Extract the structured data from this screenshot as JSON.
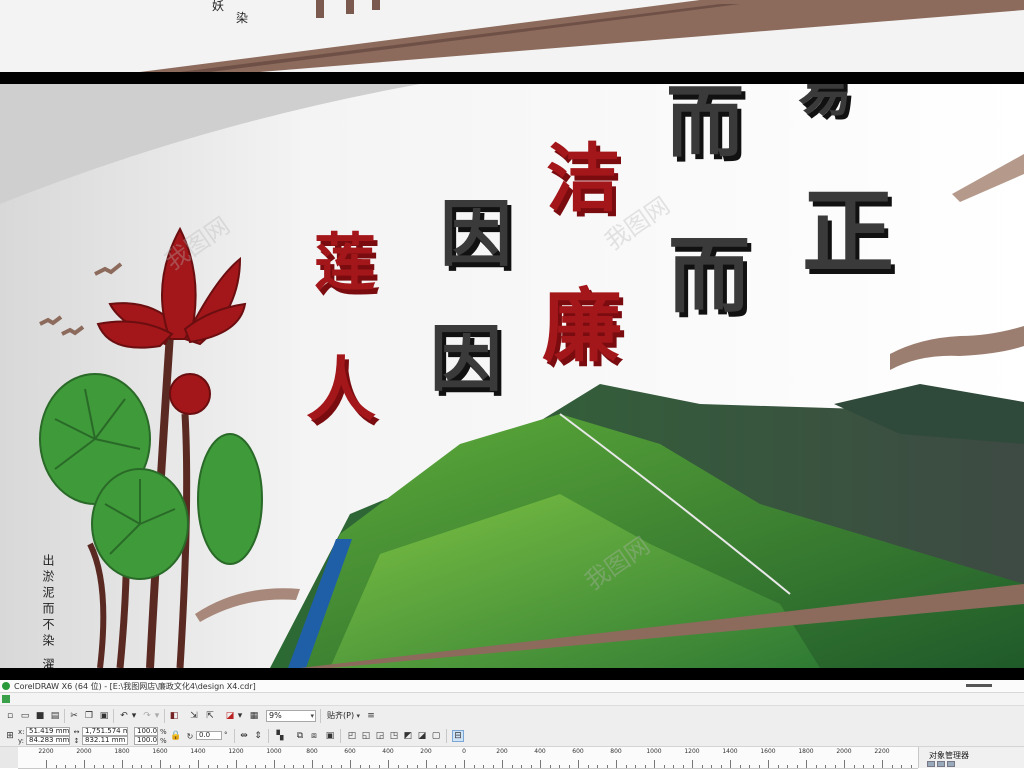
{
  "preview": {
    "top_panel_chars": [
      "妖",
      "染"
    ],
    "main_panel": {
      "red_chars": [
        "莲",
        "人",
        "洁",
        "廉"
      ],
      "dark_chars": [
        "因",
        "因",
        "而",
        "而",
        "正",
        "易"
      ],
      "side_text": "出淤泥而不染 濯清涟而不妖"
    },
    "watermark": "我图网"
  },
  "app": {
    "title": "CorelDRAW X6 (64 位) - [E:\\我图网店\\廉政文化4\\design X4.cdr]"
  },
  "toolbar": {
    "zoom_value": "9%",
    "snap_label": "贴齐(P)"
  },
  "propbar": {
    "x_label": "x:",
    "y_label": "y:",
    "x_value": "51.419 mm",
    "y_value": "84.283 mm",
    "w_value": "1,751.574 mm",
    "h_value": "832.11 mm",
    "scale_x": "100.0",
    "scale_y": "100.0",
    "pct": "%",
    "rotation": "0.0",
    "degree": "°"
  },
  "ruler": {
    "labels": [
      "2200",
      "2000",
      "1800",
      "1600",
      "1400",
      "1200",
      "1000",
      "800",
      "600",
      "400",
      "200",
      "0",
      "200",
      "400",
      "600",
      "800",
      "1000",
      "1200",
      "1400",
      "1600",
      "1800",
      "2000",
      "2200"
    ]
  },
  "docker": {
    "title": "对象管理器"
  },
  "colors": {
    "lotus_red": "#a3161a",
    "leaf_green": "#3f9a3a",
    "mountain_green": "#2f6e35",
    "char_dark": "#2e2e2e",
    "wood": "#8c6a5c"
  }
}
